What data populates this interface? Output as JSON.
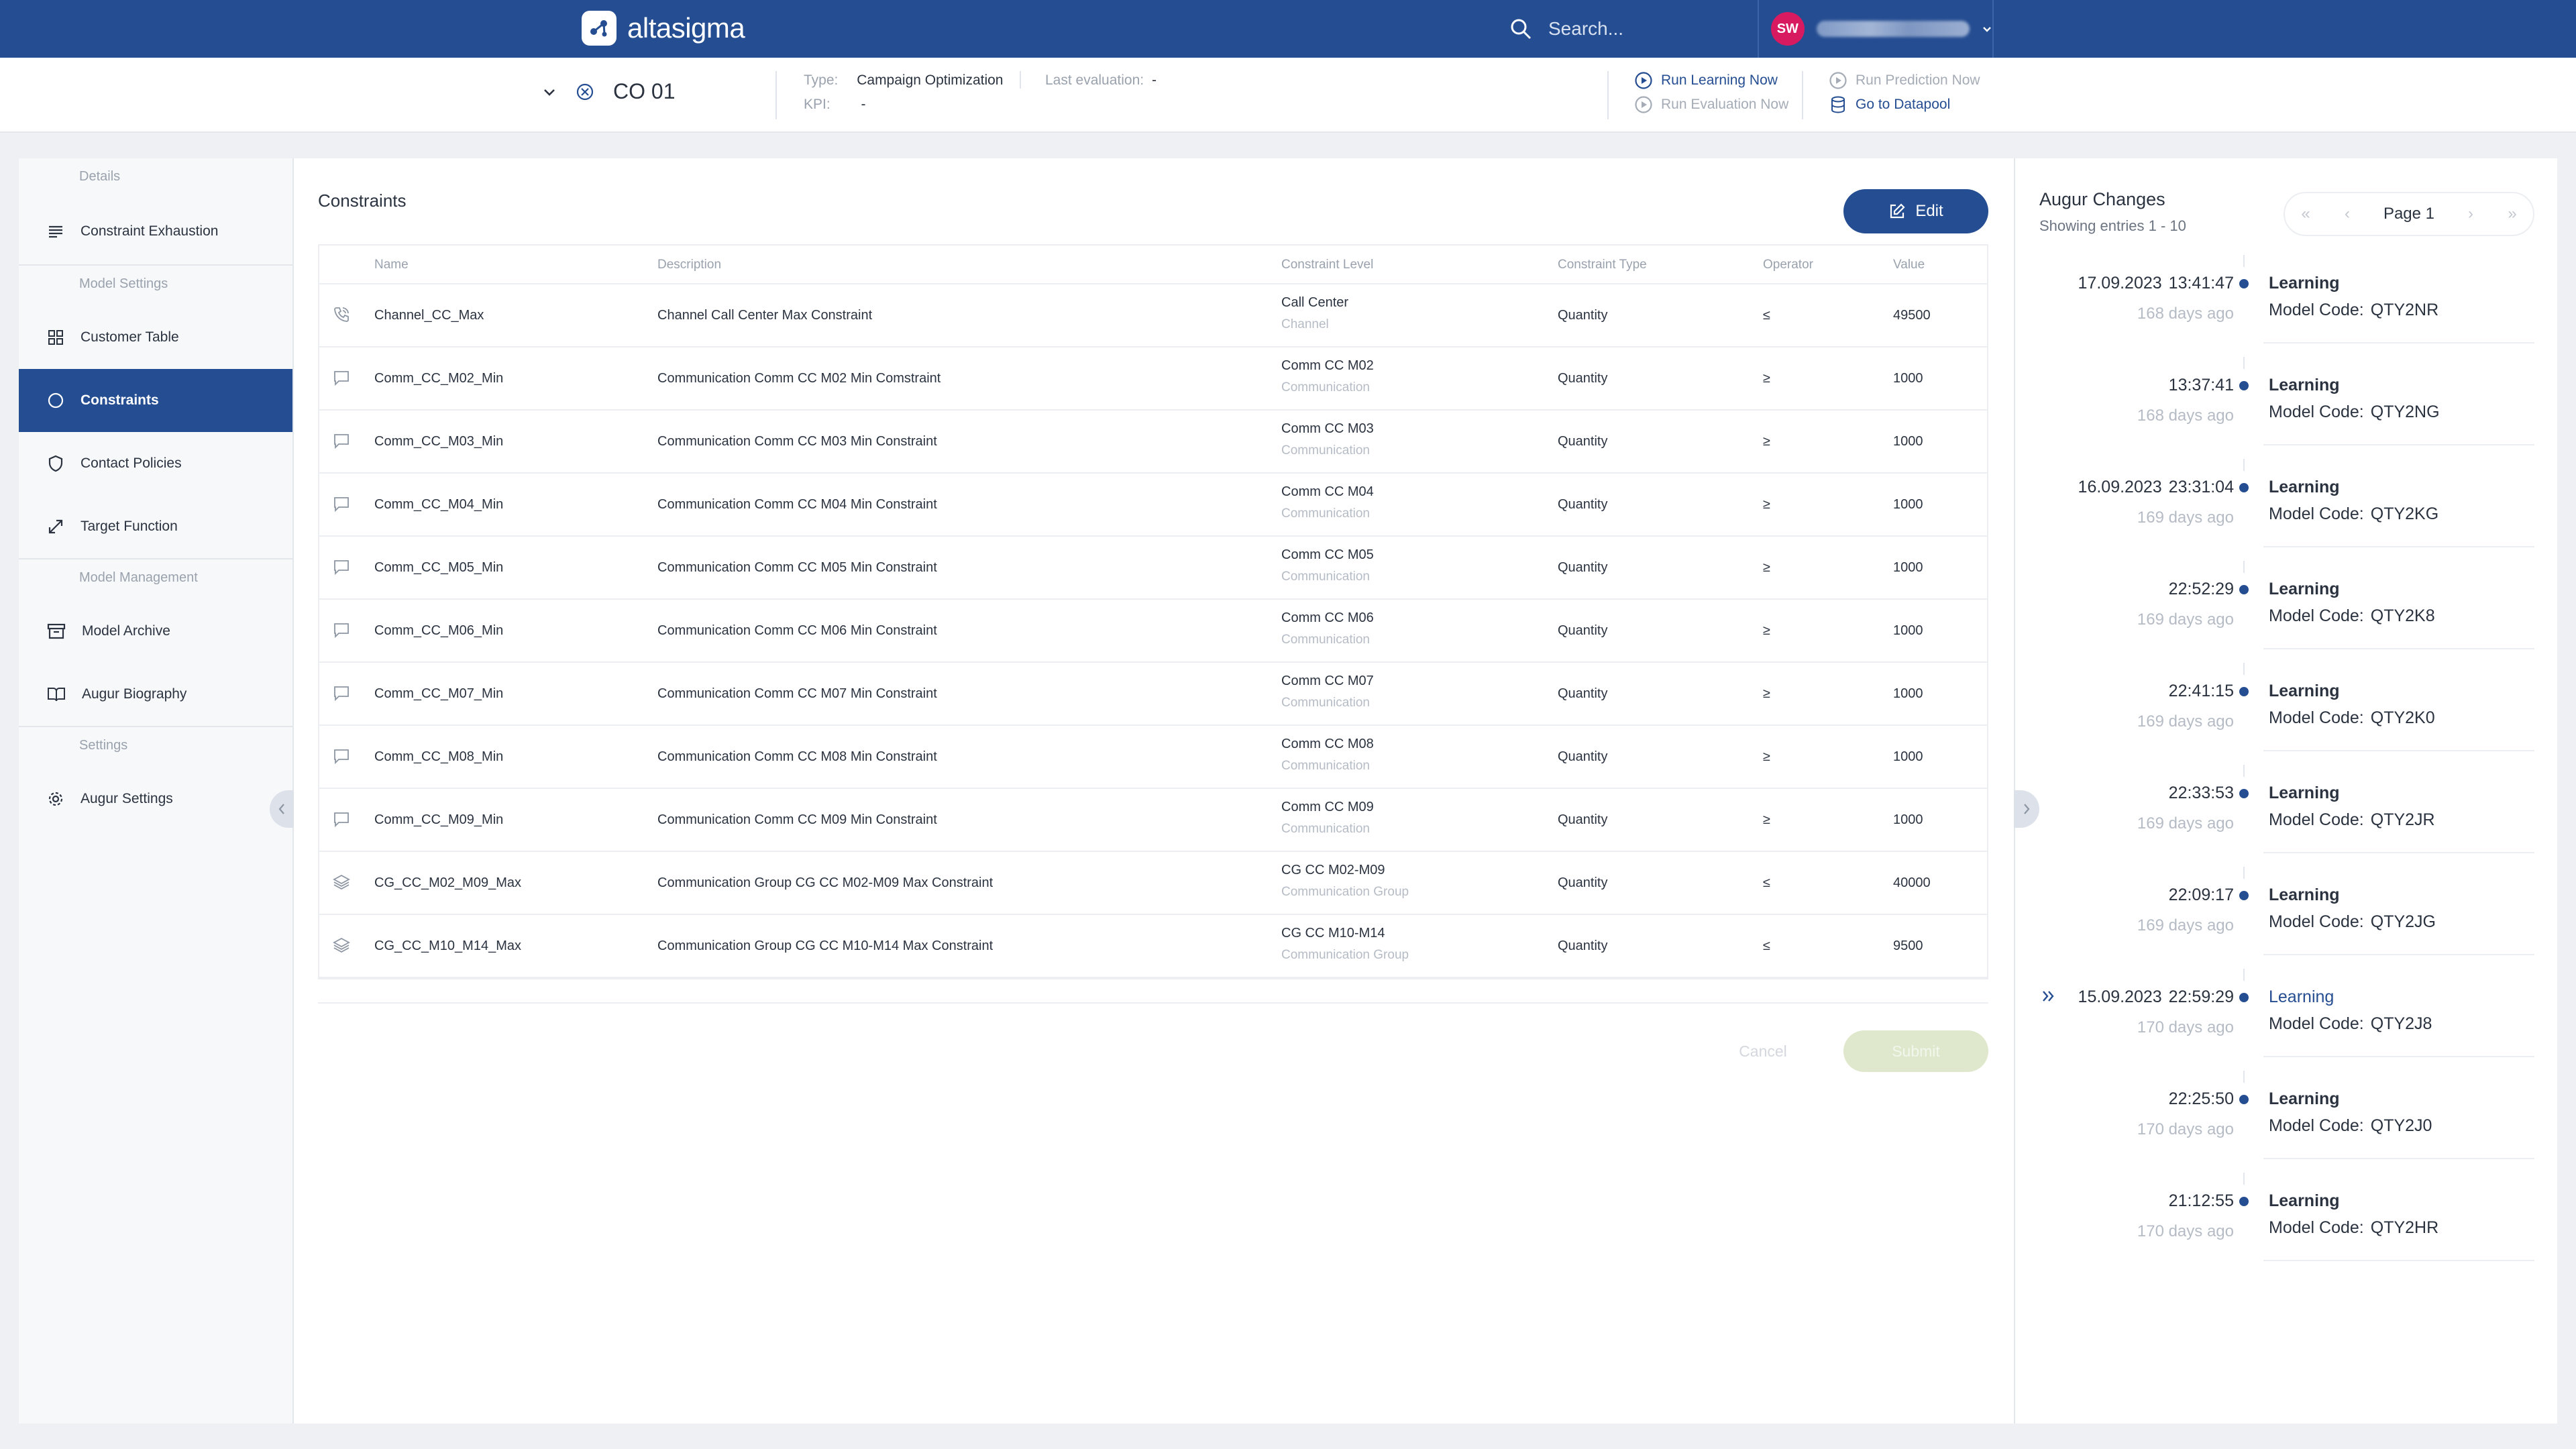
{
  "app": {
    "brand": "altasigma"
  },
  "topbar": {
    "search_placeholder": "Search...",
    "user_initials": "SW"
  },
  "subheader": {
    "model_name": "CO 01",
    "type_label": "Type:",
    "type_value": "Campaign Optimization",
    "kpi_label": "KPI:",
    "kpi_value": "-",
    "last_eval_label": "Last evaluation:",
    "last_eval_value": "-",
    "actions": {
      "run_learning": "Run Learning Now",
      "run_evaluation": "Run Evaluation Now",
      "run_prediction": "Run Prediction Now",
      "go_datapool": "Go to Datapool"
    }
  },
  "nav": {
    "group_details": "Details",
    "constraint_exhaustion": "Constraint Exhaustion",
    "group_model_settings": "Model Settings",
    "customer_table": "Customer Table",
    "constraints": "Constraints",
    "contact_policies": "Contact Policies",
    "target_function": "Target Function",
    "group_model_management": "Model Management",
    "model_archive": "Model Archive",
    "augur_biography": "Augur Biography",
    "group_settings": "Settings",
    "augur_settings": "Augur Settings"
  },
  "main": {
    "title": "Constraints",
    "edit_label": "Edit",
    "cancel_label": "Cancel",
    "submit_label": "Submit",
    "columns": {
      "name": "Name",
      "description": "Description",
      "level": "Constraint Level",
      "type": "Constraint Type",
      "operator": "Operator",
      "value": "Value"
    },
    "rows": [
      {
        "icon": "phone-icon",
        "name": "Channel_CC_Max",
        "description": "Channel Call Center Max Constraint",
        "level": "Call Center",
        "level_type": "Channel",
        "type": "Quantity",
        "operator": "≤",
        "value": "49500"
      },
      {
        "icon": "message-icon",
        "name": "Comm_CC_M02_Min",
        "description": "Communication Comm CC M02 Min Comstraint",
        "level": "Comm CC M02",
        "level_type": "Communication",
        "type": "Quantity",
        "operator": "≥",
        "value": "1000"
      },
      {
        "icon": "message-icon",
        "name": "Comm_CC_M03_Min",
        "description": "Communication Comm CC M03 Min Constraint",
        "level": "Comm CC M03",
        "level_type": "Communication",
        "type": "Quantity",
        "operator": "≥",
        "value": "1000"
      },
      {
        "icon": "message-icon",
        "name": "Comm_CC_M04_Min",
        "description": "Communication Comm CC M04 Min Constraint",
        "level": "Comm CC M04",
        "level_type": "Communication",
        "type": "Quantity",
        "operator": "≥",
        "value": "1000"
      },
      {
        "icon": "message-icon",
        "name": "Comm_CC_M05_Min",
        "description": "Communication Comm CC M05 Min Constraint",
        "level": "Comm CC M05",
        "level_type": "Communication",
        "type": "Quantity",
        "operator": "≥",
        "value": "1000"
      },
      {
        "icon": "message-icon",
        "name": "Comm_CC_M06_Min",
        "description": "Communication Comm CC M06 Min Constraint",
        "level": "Comm CC M06",
        "level_type": "Communication",
        "type": "Quantity",
        "operator": "≥",
        "value": "1000"
      },
      {
        "icon": "message-icon",
        "name": "Comm_CC_M07_Min",
        "description": "Communication Comm CC M07 Min Constraint",
        "level": "Comm CC M07",
        "level_type": "Communication",
        "type": "Quantity",
        "operator": "≥",
        "value": "1000"
      },
      {
        "icon": "message-icon",
        "name": "Comm_CC_M08_Min",
        "description": "Communication Comm CC M08 Min Constraint",
        "level": "Comm CC M08",
        "level_type": "Communication",
        "type": "Quantity",
        "operator": "≥",
        "value": "1000"
      },
      {
        "icon": "message-icon",
        "name": "Comm_CC_M09_Min",
        "description": "Communication Comm CC M09 Min Constraint",
        "level": "Comm CC M09",
        "level_type": "Communication",
        "type": "Quantity",
        "operator": "≥",
        "value": "1000"
      },
      {
        "icon": "layers-icon",
        "name": "CG_CC_M02_M09_Max",
        "description": "Communication Group CG CC M02-M09 Max Constraint",
        "level": "CG CC M02-M09",
        "level_type": "Communication Group",
        "type": "Quantity",
        "operator": "≤",
        "value": "40000"
      },
      {
        "icon": "layers-icon",
        "name": "CG_CC_M10_M14_Max",
        "description": "Communication Group CG CC M10-M14 Max Constraint",
        "level": "CG CC M10-M14",
        "level_type": "Communication Group",
        "type": "Quantity",
        "operator": "≤",
        "value": "9500"
      }
    ]
  },
  "augur_changes": {
    "title": "Augur Changes",
    "showing": "Showing entries 1 - 10",
    "page_label": "Page 1",
    "entries": [
      {
        "date": "17.09.2023",
        "time": "13:41:47",
        "ago": "168 days ago",
        "kind": "Learning",
        "code_label": "Model Code:",
        "code": "QTY2NR",
        "selected": false
      },
      {
        "date": "",
        "time": "13:37:41",
        "ago": "168 days ago",
        "kind": "Learning",
        "code_label": "Model Code:",
        "code": "QTY2NG",
        "selected": false
      },
      {
        "date": "16.09.2023",
        "time": "23:31:04",
        "ago": "169 days ago",
        "kind": "Learning",
        "code_label": "Model Code:",
        "code": "QTY2KG",
        "selected": false
      },
      {
        "date": "",
        "time": "22:52:29",
        "ago": "169 days ago",
        "kind": "Learning",
        "code_label": "Model Code:",
        "code": "QTY2K8",
        "selected": false
      },
      {
        "date": "",
        "time": "22:41:15",
        "ago": "169 days ago",
        "kind": "Learning",
        "code_label": "Model Code:",
        "code": "QTY2K0",
        "selected": false
      },
      {
        "date": "",
        "time": "22:33:53",
        "ago": "169 days ago",
        "kind": "Learning",
        "code_label": "Model Code:",
        "code": "QTY2JR",
        "selected": false
      },
      {
        "date": "",
        "time": "22:09:17",
        "ago": "169 days ago",
        "kind": "Learning",
        "code_label": "Model Code:",
        "code": "QTY2JG",
        "selected": false
      },
      {
        "date": "15.09.2023",
        "time": "22:59:29",
        "ago": "170 days ago",
        "kind": "Learning",
        "code_label": "Model Code:",
        "code": "QTY2J8",
        "selected": true
      },
      {
        "date": "",
        "time": "22:25:50",
        "ago": "170 days ago",
        "kind": "Learning",
        "code_label": "Model Code:",
        "code": "QTY2J0",
        "selected": false
      },
      {
        "date": "",
        "time": "21:12:55",
        "ago": "170 days ago",
        "kind": "Learning",
        "code_label": "Model Code:",
        "code": "QTY2HR",
        "selected": false
      }
    ]
  },
  "colors": {
    "brand": "#254d91",
    "avatar": "#d81b60",
    "submit_disabled": "#dfe8cc"
  }
}
